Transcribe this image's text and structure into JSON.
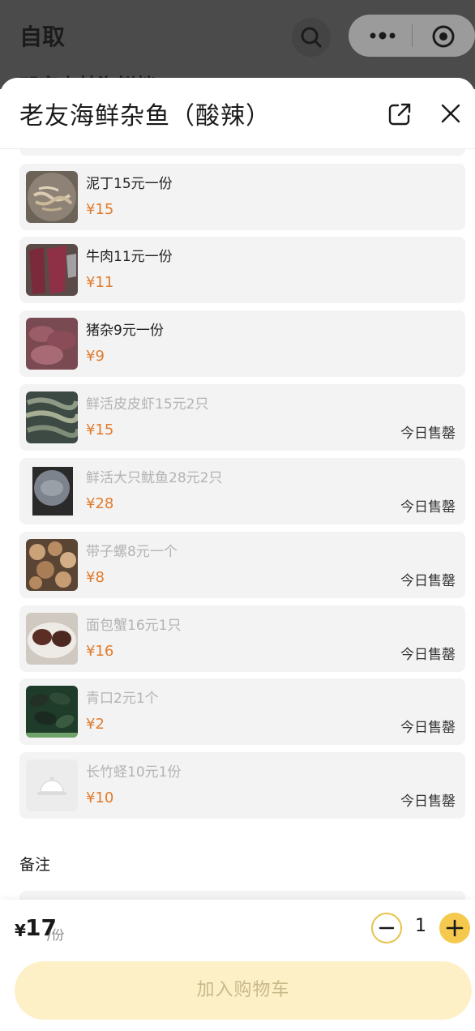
{
  "background": {
    "title": "自取",
    "behind_text": "邓家中林海鲜档"
  },
  "sheet": {
    "title": "老友海鲜杂鱼（酸辣）"
  },
  "items": [
    {
      "name": "泥丁15元一份",
      "price": "¥15",
      "sold_out": false,
      "image": "pale-worms-in-bowl-photo"
    },
    {
      "name": "牛肉11元一份",
      "price": "¥11",
      "sold_out": false,
      "image": "beef-photo"
    },
    {
      "name": "猪杂9元一份",
      "price": "¥9",
      "sold_out": false,
      "image": "pork-offal-photo"
    },
    {
      "name": "鲜活皮皮虾15元2只",
      "price": "¥15",
      "sold_out": true,
      "sold_out_label": "今日售罄",
      "image": "mantis-shrimp-photo"
    },
    {
      "name": "鲜活大只鱿鱼28元2只",
      "price": "¥28",
      "sold_out": true,
      "sold_out_label": "今日售罄",
      "image": "squid-photo"
    },
    {
      "name": "带子螺8元一个",
      "price": "¥8",
      "sold_out": true,
      "sold_out_label": "今日售罄",
      "image": "sea-snail-photo"
    },
    {
      "name": "面包蟹16元1只",
      "price": "¥16",
      "sold_out": true,
      "sold_out_label": "今日售罄",
      "image": "crab-photo"
    },
    {
      "name": "青口2元1个",
      "price": "¥2",
      "sold_out": true,
      "sold_out_label": "今日售罄",
      "image": "mussels-photo"
    },
    {
      "name": "长竹蛏10元1份",
      "price": "¥10",
      "sold_out": true,
      "sold_out_label": "今日售罄",
      "image": "placeholder-dish-icon"
    }
  ],
  "remarks": {
    "label": "备注"
  },
  "footer": {
    "currency": "¥",
    "price": "17",
    "unit": "/份",
    "quantity": "1",
    "add_to_cart": "加入购物车"
  },
  "colors": {
    "price_accent": "#e07b2c",
    "plus_button": "#f5c94d",
    "cart_button_disabled": "#fdf0c7"
  }
}
